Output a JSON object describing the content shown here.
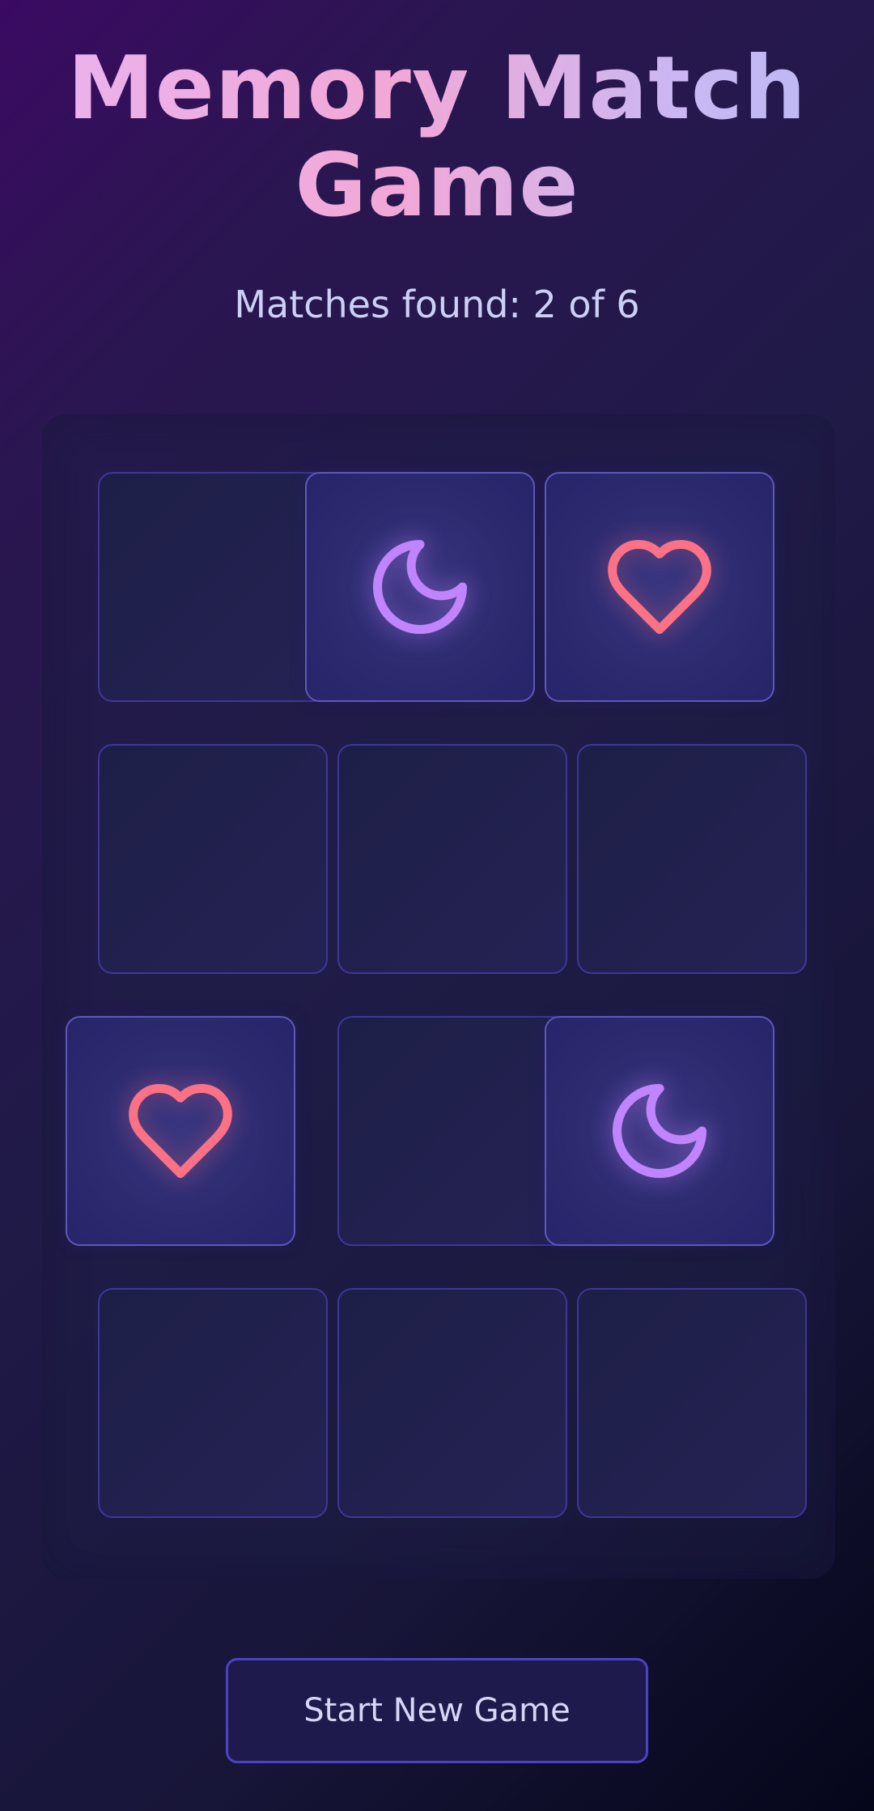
{
  "header": {
    "title": "Memory Match Game",
    "status": "Matches found: 2 of 6"
  },
  "board": {
    "cards": [
      {
        "state": "hidden"
      },
      {
        "state": "flipped",
        "icon": "moon-icon"
      },
      {
        "state": "flipped",
        "icon": "heart-icon"
      },
      {
        "state": "hidden"
      },
      {
        "state": "hidden"
      },
      {
        "state": "hidden"
      },
      {
        "state": "flipped",
        "icon": "heart-icon"
      },
      {
        "state": "hidden"
      },
      {
        "state": "flipped",
        "icon": "moon-icon"
      },
      {
        "state": "hidden"
      },
      {
        "state": "hidden"
      },
      {
        "state": "hidden"
      }
    ]
  },
  "controls": {
    "new_game_label": "Start New Game"
  },
  "colors": {
    "moon": "#c084fc",
    "heart": "#fb7185",
    "accent": "#4b43c4"
  }
}
